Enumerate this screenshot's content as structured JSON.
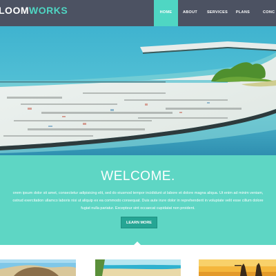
{
  "header": {
    "logo_part1": "LOOM",
    "logo_part2": "WORKS",
    "nav": [
      {
        "label": "HOME",
        "active": true
      },
      {
        "label": "ABOUT",
        "active": false
      },
      {
        "label": "SERVICES",
        "active": false
      },
      {
        "label": "PLANS",
        "active": false
      },
      {
        "label": "CONC",
        "active": false
      }
    ]
  },
  "welcome": {
    "title": "WELCOME.",
    "body": "orem ipsum dolor sit amet, consectetur adipisicing elit, sed do eiusmod tempor incididunt ut labore et dolore magna aliqua. Ut enim ad minim veniam,\nostrud exercitation ullamco laboris nisi ut aliquip ex ea commodo consequat. Duis aute irure dolor in reprehenderit in voluptate velit esse cillum dolore\nfugiat nulla pariatur. Excepteur sint occaecat cupidatat non proident.",
    "button_label": "LEARN MORE"
  },
  "colors": {
    "header_bg": "#4c5262",
    "accent": "#4fd6c3",
    "welcome_bg": "#5ed6c4",
    "button_bg": "#26a594"
  }
}
